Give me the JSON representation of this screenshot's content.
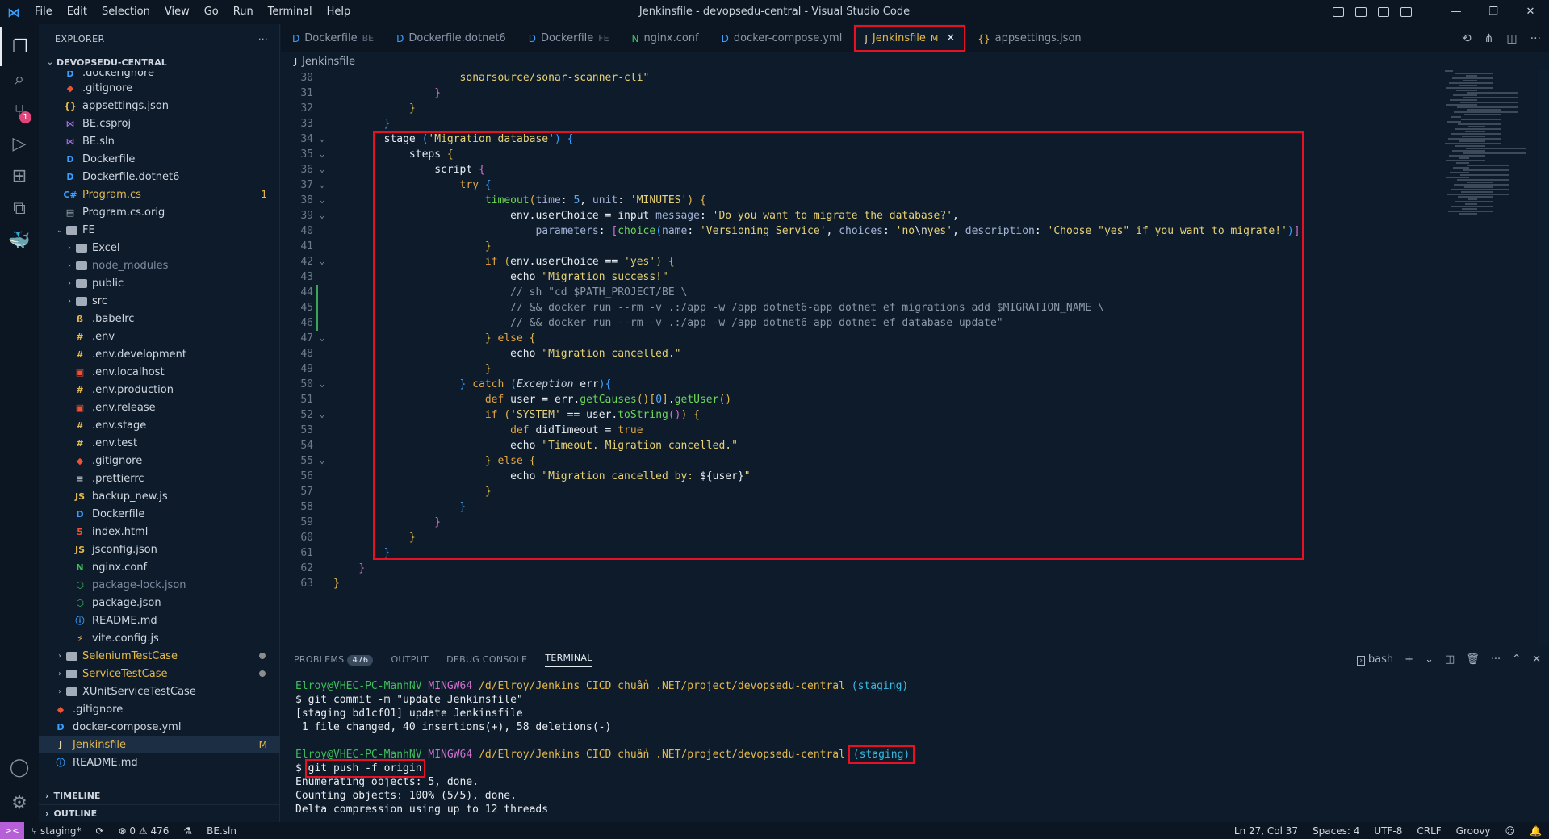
{
  "window": {
    "title": "Jenkinsfile - devopsedu-central - Visual Studio Code",
    "menu": [
      "File",
      "Edit",
      "Selection",
      "View",
      "Go",
      "Run",
      "Terminal",
      "Help"
    ],
    "controls": {
      "minimize": "—",
      "restore": "❐",
      "close": "✕"
    }
  },
  "activity_bar": {
    "items": [
      {
        "name": "explorer-icon",
        "glyph": "❐"
      },
      {
        "name": "search-icon",
        "glyph": "⌕"
      },
      {
        "name": "source-control-icon",
        "glyph": "⑂",
        "badge": "1"
      },
      {
        "name": "run-debug-icon",
        "glyph": "▷"
      },
      {
        "name": "extensions-icon",
        "glyph": "⊞"
      },
      {
        "name": "remote-explorer-icon",
        "glyph": "⧉"
      },
      {
        "name": "docker-icon",
        "glyph": "🐳"
      }
    ],
    "account_glyph": "◯",
    "settings_glyph": "⚙"
  },
  "sidebar": {
    "title": "EXPLORER",
    "more": "···",
    "root": "DEVOPSEDU-CENTRAL",
    "items": [
      {
        "label": ".dockerignore",
        "icon": "D",
        "iconColor": "#3aa0ff",
        "indent": 2
      },
      {
        "label": ".gitignore",
        "icon": "◆",
        "iconColor": "#f05133",
        "indent": 2
      },
      {
        "label": "appsettings.json",
        "icon": "{}",
        "iconColor": "#e5b84a",
        "indent": 2
      },
      {
        "label": "BE.csproj",
        "icon": "⋈",
        "iconColor": "#a16bdb",
        "indent": 2
      },
      {
        "label": "BE.sln",
        "icon": "⋈",
        "iconColor": "#a16bdb",
        "indent": 2
      },
      {
        "label": "Dockerfile",
        "icon": "D",
        "iconColor": "#3aa0ff",
        "indent": 2
      },
      {
        "label": "Dockerfile.dotnet6",
        "icon": "D",
        "iconColor": "#3aa0ff",
        "indent": 2
      },
      {
        "label": "Program.cs",
        "icon": "C#",
        "iconColor": "#3aa0ff",
        "indent": 2,
        "labelColor": "#e5b84a",
        "badge": "1",
        "badgeColor": "#e5b84a"
      },
      {
        "label": "Program.cs.orig",
        "icon": "▤",
        "iconColor": "#aab3bf",
        "indent": 2
      },
      {
        "label": "FE",
        "folder": true,
        "open": true,
        "indent": 1
      },
      {
        "label": "Excel",
        "folder": true,
        "indent": 2
      },
      {
        "label": "node_modules",
        "folder": true,
        "indent": 2,
        "labelColor": "#7e8ba0"
      },
      {
        "label": "public",
        "folder": true,
        "indent": 2
      },
      {
        "label": "src",
        "folder": true,
        "indent": 2
      },
      {
        "label": ".babelrc",
        "icon": "ß",
        "iconColor": "#e5b84a",
        "indent": 3
      },
      {
        "label": ".env",
        "icon": "#",
        "iconColor": "#e5b84a",
        "indent": 3
      },
      {
        "label": ".env.development",
        "icon": "#",
        "iconColor": "#e5b84a",
        "indent": 3
      },
      {
        "label": ".env.localhost",
        "icon": "▣",
        "iconColor": "#f05133",
        "indent": 3
      },
      {
        "label": ".env.production",
        "icon": "#",
        "iconColor": "#e5b84a",
        "indent": 3
      },
      {
        "label": ".env.release",
        "icon": "▣",
        "iconColor": "#f05133",
        "indent": 3
      },
      {
        "label": ".env.stage",
        "icon": "#",
        "iconColor": "#e5b84a",
        "indent": 3
      },
      {
        "label": ".env.test",
        "icon": "#",
        "iconColor": "#e5b84a",
        "indent": 3
      },
      {
        "label": ".gitignore",
        "icon": "◆",
        "iconColor": "#f05133",
        "indent": 3
      },
      {
        "label": ".prettierrc",
        "icon": "≡",
        "iconColor": "#aab3bf",
        "indent": 3
      },
      {
        "label": "backup_new.js",
        "icon": "JS",
        "iconColor": "#e5b84a",
        "indent": 3
      },
      {
        "label": "Dockerfile",
        "icon": "D",
        "iconColor": "#3aa0ff",
        "indent": 3
      },
      {
        "label": "index.html",
        "icon": "5",
        "iconColor": "#f05133",
        "indent": 3
      },
      {
        "label": "jsconfig.json",
        "icon": "JS",
        "iconColor": "#e5b84a",
        "indent": 3
      },
      {
        "label": "nginx.conf",
        "icon": "N",
        "iconColor": "#3fbf5a",
        "indent": 3
      },
      {
        "label": "package-lock.json",
        "icon": "⬡",
        "iconColor": "#3fbf5a",
        "indent": 3,
        "labelColor": "#7e8ba0"
      },
      {
        "label": "package.json",
        "icon": "⬡",
        "iconColor": "#3fbf5a",
        "indent": 3
      },
      {
        "label": "README.md",
        "icon": "ⓘ",
        "iconColor": "#3aa0ff",
        "indent": 3
      },
      {
        "label": "vite.config.js",
        "icon": "⚡",
        "iconColor": "#e5b84a",
        "indent": 3
      },
      {
        "label": "SeleniumTestCase",
        "folder": true,
        "indent": 1,
        "labelColor": "#e5b84a",
        "dot": true
      },
      {
        "label": "ServiceTestCase",
        "folder": true,
        "indent": 1,
        "labelColor": "#e5b84a",
        "dot": true
      },
      {
        "label": "XUnitServiceTestCase",
        "folder": true,
        "indent": 1
      },
      {
        "label": ".gitignore",
        "icon": "◆",
        "iconColor": "#f05133",
        "indent": 1
      },
      {
        "label": "docker-compose.yml",
        "icon": "D",
        "iconColor": "#3aa0ff",
        "indent": 1
      },
      {
        "label": "Jenkinsfile",
        "icon": "J",
        "iconColor": "#e8d6b0",
        "indent": 1,
        "labelColor": "#e5b84a",
        "badge": "M",
        "badgeColor": "#e5b84a",
        "selected": true
      },
      {
        "label": "README.md",
        "icon": "ⓘ",
        "iconColor": "#3aa0ff",
        "indent": 1
      }
    ],
    "timeline": "TIMELINE",
    "outline": "OUTLINE"
  },
  "tabs": [
    {
      "label": "Dockerfile",
      "desc": "BE",
      "icon": "D",
      "iconColor": "#3aa0ff"
    },
    {
      "label": "Dockerfile.dotnet6",
      "desc": "",
      "icon": "D",
      "iconColor": "#3aa0ff"
    },
    {
      "label": "Dockerfile",
      "desc": "FE",
      "icon": "D",
      "iconColor": "#3aa0ff"
    },
    {
      "label": "nginx.conf",
      "desc": "",
      "icon": "N",
      "iconColor": "#3fbf5a"
    },
    {
      "label": "docker-compose.yml",
      "desc": "",
      "icon": "D",
      "iconColor": "#3aa0ff"
    },
    {
      "label": "Jenkinsfile",
      "desc": "M",
      "icon": "J",
      "iconColor": "#e8d6b0",
      "active": true,
      "close": "✕"
    },
    {
      "label": "appsettings.json",
      "desc": "",
      "icon": "{}",
      "iconColor": "#e5b84a"
    }
  ],
  "editor_actions": [
    "⟲",
    "⋔",
    "◫",
    "···"
  ],
  "breadcrumb": {
    "icon": "J",
    "label": "Jenkinsfile"
  },
  "code": [
    {
      "n": "30",
      "seg": [
        [
          "                    ",
          ""
        ],
        [
          "sonarsource/sonar-scanner-cli\"",
          "str"
        ]
      ]
    },
    {
      "n": "31",
      "seg": [
        [
          "                ",
          ""
        ],
        [
          "}",
          "br2"
        ]
      ]
    },
    {
      "n": "32",
      "seg": [
        [
          "            ",
          ""
        ],
        [
          "}",
          "br1"
        ]
      ]
    },
    {
      "n": "33",
      "seg": [
        [
          "        ",
          ""
        ],
        [
          "}",
          "br3"
        ]
      ]
    },
    {
      "n": "34",
      "fold": true,
      "seg": [
        [
          "        ",
          ""
        ],
        [
          "stage ",
          "ident"
        ],
        [
          "(",
          "br3"
        ],
        [
          "'Migration database'",
          "str"
        ],
        [
          ") ",
          "br3"
        ],
        [
          "{",
          "br3"
        ]
      ]
    },
    {
      "n": "35",
      "fold": true,
      "seg": [
        [
          "            ",
          ""
        ],
        [
          "steps ",
          "ident"
        ],
        [
          "{",
          "br1"
        ]
      ]
    },
    {
      "n": "36",
      "fold": true,
      "seg": [
        [
          "                ",
          ""
        ],
        [
          "script ",
          "ident"
        ],
        [
          "{",
          "br2"
        ]
      ]
    },
    {
      "n": "37",
      "fold": true,
      "seg": [
        [
          "                    ",
          ""
        ],
        [
          "try ",
          "kw"
        ],
        [
          "{",
          "br3"
        ]
      ]
    },
    {
      "n": "38",
      "fold": true,
      "seg": [
        [
          "                        ",
          ""
        ],
        [
          "timeout",
          "fn"
        ],
        [
          "(",
          "br1"
        ],
        [
          "time",
          "par"
        ],
        [
          ": ",
          "ident"
        ],
        [
          "5",
          "lit"
        ],
        [
          ", ",
          "ident"
        ],
        [
          "unit",
          "par"
        ],
        [
          ": ",
          "ident"
        ],
        [
          "'MINUTES'",
          "str"
        ],
        [
          ") ",
          "br1"
        ],
        [
          "{",
          "br1"
        ]
      ]
    },
    {
      "n": "39",
      "fold": true,
      "seg": [
        [
          "                            ",
          ""
        ],
        [
          "env.userChoice = input ",
          "ident"
        ],
        [
          "message",
          "par"
        ],
        [
          ": ",
          "ident"
        ],
        [
          "'Do you want to migrate the database?'",
          "str"
        ],
        [
          ",",
          "ident"
        ]
      ]
    },
    {
      "n": "40",
      "seg": [
        [
          "                                ",
          ""
        ],
        [
          "parameters",
          "par"
        ],
        [
          ": ",
          "ident"
        ],
        [
          "[",
          "br2"
        ],
        [
          "choice",
          "fn"
        ],
        [
          "(",
          "br3"
        ],
        [
          "name",
          "par"
        ],
        [
          ": ",
          "ident"
        ],
        [
          "'Versioning Service'",
          "str"
        ],
        [
          ", ",
          "ident"
        ],
        [
          "choices",
          "par"
        ],
        [
          ": ",
          "ident"
        ],
        [
          "'no",
          "str"
        ],
        [
          "\\n",
          "esc"
        ],
        [
          "yes'",
          "str"
        ],
        [
          ", ",
          "ident"
        ],
        [
          "description",
          "par"
        ],
        [
          ": ",
          "ident"
        ],
        [
          "'Choose \"yes\" if you want to migrate!'",
          "str"
        ],
        [
          ")",
          "br3"
        ],
        [
          "]",
          "br2"
        ]
      ]
    },
    {
      "n": "41",
      "seg": [
        [
          "                        ",
          ""
        ],
        [
          "}",
          "br1"
        ]
      ]
    },
    {
      "n": "42",
      "fold": true,
      "seg": [
        [
          "                        ",
          ""
        ],
        [
          "if ",
          "kw"
        ],
        [
          "(",
          "br1"
        ],
        [
          "env.userChoice == ",
          "ident"
        ],
        [
          "'yes'",
          "str"
        ],
        [
          ") ",
          "br1"
        ],
        [
          "{",
          "br1"
        ]
      ]
    },
    {
      "n": "43",
      "seg": [
        [
          "                            ",
          ""
        ],
        [
          "echo ",
          "ident"
        ],
        [
          "\"Migration success!\"",
          "str"
        ]
      ]
    },
    {
      "n": "44",
      "git": true,
      "seg": [
        [
          "                            ",
          ""
        ],
        [
          "// sh \"cd $PATH_PROJECT/BE \\",
          "cm"
        ]
      ]
    },
    {
      "n": "45",
      "git": true,
      "seg": [
        [
          "                            ",
          ""
        ],
        [
          "// && docker run --rm -v .:/app -w /app dotnet6-app dotnet ef migrations add $MIGRATION_NAME \\",
          "cm"
        ]
      ]
    },
    {
      "n": "46",
      "git": true,
      "seg": [
        [
          "                            ",
          ""
        ],
        [
          "// && docker run --rm -v .:/app -w /app dotnet6-app dotnet ef database update\"",
          "cm"
        ]
      ]
    },
    {
      "n": "47",
      "fold": true,
      "seg": [
        [
          "                        ",
          ""
        ],
        [
          "} ",
          "br1"
        ],
        [
          "else ",
          "kw"
        ],
        [
          "{",
          "br1"
        ]
      ]
    },
    {
      "n": "48",
      "seg": [
        [
          "                            ",
          ""
        ],
        [
          "echo ",
          "ident"
        ],
        [
          "\"Migration cancelled.\"",
          "str"
        ]
      ]
    },
    {
      "n": "49",
      "seg": [
        [
          "                        ",
          ""
        ],
        [
          "}",
          "br1"
        ]
      ]
    },
    {
      "n": "50",
      "fold": true,
      "seg": [
        [
          "                    ",
          ""
        ],
        [
          "} ",
          "br3"
        ],
        [
          "catch ",
          "kw"
        ],
        [
          "(",
          "br3"
        ],
        [
          "Exception ",
          "ital"
        ],
        [
          "err",
          "ident"
        ],
        [
          ")",
          "br3"
        ],
        [
          "{",
          "br3"
        ]
      ]
    },
    {
      "n": "51",
      "seg": [
        [
          "                        ",
          ""
        ],
        [
          "def ",
          "kw"
        ],
        [
          "user = err.",
          "ident"
        ],
        [
          "getCauses",
          "fn"
        ],
        [
          "()",
          "br1"
        ],
        [
          "[",
          "br1"
        ],
        [
          "0",
          "lit"
        ],
        [
          "]",
          "br1"
        ],
        [
          ".",
          "ident"
        ],
        [
          "getUser",
          "fn"
        ],
        [
          "()",
          "br1"
        ]
      ]
    },
    {
      "n": "52",
      "fold": true,
      "seg": [
        [
          "                        ",
          ""
        ],
        [
          "if ",
          "kw"
        ],
        [
          "(",
          "br1"
        ],
        [
          "'SYSTEM'",
          "str"
        ],
        [
          " == user.",
          "ident"
        ],
        [
          "toString",
          "fn"
        ],
        [
          "()",
          "br2"
        ],
        [
          ") ",
          "br1"
        ],
        [
          "{",
          "br1"
        ]
      ]
    },
    {
      "n": "53",
      "seg": [
        [
          "                            ",
          ""
        ],
        [
          "def ",
          "kw"
        ],
        [
          "didTimeout = ",
          "ident"
        ],
        [
          "true",
          "kw"
        ]
      ]
    },
    {
      "n": "54",
      "seg": [
        [
          "                            ",
          ""
        ],
        [
          "echo ",
          "ident"
        ],
        [
          "\"Timeout. Migration cancelled.\"",
          "str"
        ]
      ]
    },
    {
      "n": "55",
      "fold": true,
      "seg": [
        [
          "                        ",
          ""
        ],
        [
          "} ",
          "br1"
        ],
        [
          "else ",
          "kw"
        ],
        [
          "{",
          "br1"
        ]
      ]
    },
    {
      "n": "56",
      "seg": [
        [
          "                            ",
          ""
        ],
        [
          "echo ",
          "ident"
        ],
        [
          "\"Migration cancelled by: ",
          "str"
        ],
        [
          "${user}",
          "ident"
        ],
        [
          "\"",
          "str"
        ]
      ]
    },
    {
      "n": "57",
      "seg": [
        [
          "                        ",
          ""
        ],
        [
          "}",
          "br1"
        ]
      ]
    },
    {
      "n": "58",
      "seg": [
        [
          "                    ",
          ""
        ],
        [
          "}",
          "br3"
        ]
      ]
    },
    {
      "n": "59",
      "seg": [
        [
          "                ",
          ""
        ],
        [
          "}",
          "br2"
        ]
      ]
    },
    {
      "n": "60",
      "seg": [
        [
          "            ",
          ""
        ],
        [
          "}",
          "br1"
        ]
      ]
    },
    {
      "n": "61",
      "seg": [
        [
          "        ",
          ""
        ],
        [
          "}",
          "br3"
        ]
      ]
    },
    {
      "n": "62",
      "seg": [
        [
          "    ",
          ""
        ],
        [
          "}",
          "br2"
        ]
      ]
    },
    {
      "n": "63",
      "seg": [
        [
          "",
          ""
        ],
        [
          "}",
          "br1"
        ]
      ]
    }
  ],
  "panel": {
    "tabs": [
      {
        "label": "PROBLEMS",
        "badge": "476"
      },
      {
        "label": "OUTPUT"
      },
      {
        "label": "DEBUG CONSOLE"
      },
      {
        "label": "TERMINAL",
        "active": true
      }
    ],
    "shell": "bash",
    "actions": [
      "+",
      "⌄",
      "◫",
      "🗑",
      "···",
      "^",
      "✕"
    ]
  },
  "terminal": {
    "prompt_user": "Elroy@VHEC-PC-ManhNV",
    "prompt_host": "MINGW64",
    "prompt_path": "/d/Elroy/Jenkins CICD chuẩn .NET/project/devopsedu-central",
    "branch": "(staging)",
    "cmd1": "$ git commit -m \"update Jenkinsfile\"",
    "out1": "[staging bd1cf01] update Jenkinsfile",
    "out2": " 1 file changed, 40 insertions(+), 58 deletions(-)",
    "cmd2_prefix": "$ ",
    "cmd2": "git push -f origin",
    "out3": "Enumerating objects: 5, done.",
    "out4": "Counting objects: 100% (5/5), done.",
    "out5": "Delta compression using up to 12 threads"
  },
  "statusbar": {
    "remote": "><",
    "branch": "⑂ staging*",
    "sync": "⟳",
    "errors": "⊗ 0 ⚠ 476",
    "ext": "⚗",
    "sln": "BE.sln",
    "cursor": "Ln 27, Col 37",
    "spaces": "Spaces: 4",
    "encoding": "UTF-8",
    "eol": "CRLF",
    "language": "Groovy",
    "feedback": "☺",
    "bell": "🔔"
  }
}
